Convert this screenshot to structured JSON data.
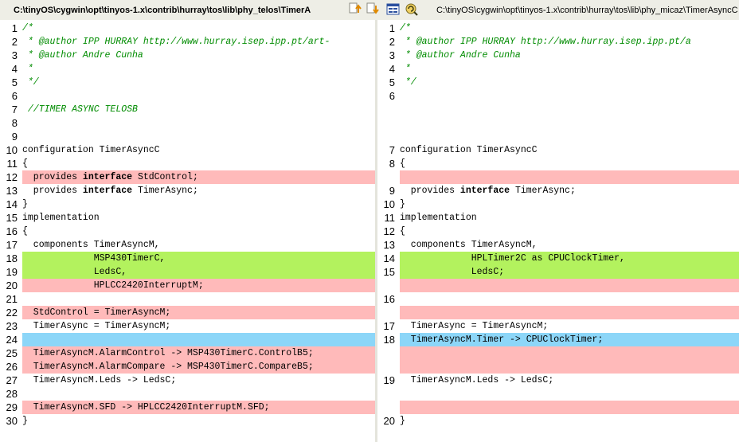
{
  "header": {
    "left_path": "C:\\tinyOS\\cygwin\\opt\\tinyos-1.x\\contrib\\hurray\\tos\\lib\\phy_telos\\TimerA",
    "right_path": "C:\\tinyOS\\cygwin\\opt\\tinyos-1.x\\contrib\\hurray\\tos\\lib\\phy_micaz\\TimerAsyncC",
    "buttons": [
      "up-arrow-icon",
      "down-arrow-icon",
      "layout-icon",
      "refresh-icon"
    ]
  },
  "left_lines": [
    {
      "n": "1",
      "t": "/*",
      "k": "cmt",
      "bg": ""
    },
    {
      "n": "2",
      "t": " * @author IPP HURRAY http://www.hurray.isep.ipp.pt/art-",
      "k": "cmt",
      "bg": ""
    },
    {
      "n": "3",
      "t": " * @author Andre Cunha",
      "k": "cmt",
      "bg": ""
    },
    {
      "n": "4",
      "t": " *",
      "k": "cmt",
      "bg": ""
    },
    {
      "n": "5",
      "t": " */",
      "k": "cmt",
      "bg": ""
    },
    {
      "n": "6",
      "t": "",
      "k": "",
      "bg": ""
    },
    {
      "n": "7",
      "t": " //TIMER ASYNC TELOSB",
      "k": "cmt",
      "bg": ""
    },
    {
      "n": "8",
      "t": "",
      "k": "",
      "bg": ""
    },
    {
      "n": "9",
      "t": "",
      "k": "",
      "bg": ""
    },
    {
      "n": "10",
      "t": "configuration TimerAsyncC",
      "k": "",
      "bg": ""
    },
    {
      "n": "11",
      "t": "{",
      "k": "",
      "bg": ""
    },
    {
      "n": "12",
      "t": "  provides |interface| StdControl;",
      "k": "",
      "bg": "d"
    },
    {
      "n": "13",
      "t": "  provides |interface| TimerAsync;",
      "k": "",
      "bg": ""
    },
    {
      "n": "14",
      "t": "}",
      "k": "",
      "bg": ""
    },
    {
      "n": "15",
      "t": "implementation",
      "k": "",
      "bg": ""
    },
    {
      "n": "16",
      "t": "{",
      "k": "",
      "bg": ""
    },
    {
      "n": "17",
      "t": "  components TimerAsyncM,",
      "k": "",
      "bg": ""
    },
    {
      "n": "18",
      "t": "             MSP430TimerC,",
      "k": "",
      "bg": "c"
    },
    {
      "n": "19",
      "t": "             LedsC,",
      "k": "",
      "bg": "c"
    },
    {
      "n": "20",
      "t": "             HPLCC2420InterruptM;",
      "k": "",
      "bg": "d"
    },
    {
      "n": "21",
      "t": "",
      "k": "",
      "bg": ""
    },
    {
      "n": "22",
      "t": "  StdControl = TimerAsyncM;",
      "k": "",
      "bg": "d"
    },
    {
      "n": "23",
      "t": "  TimerAsync = TimerAsyncM;",
      "k": "",
      "bg": ""
    },
    {
      "n": "24",
      "t": "",
      "k": "",
      "bg": "m"
    },
    {
      "n": "25",
      "t": "  TimerAsyncM.AlarmControl -> MSP430TimerC.ControlB5;",
      "k": "",
      "bg": "d"
    },
    {
      "n": "26",
      "t": "  TimerAsyncM.AlarmCompare -> MSP430TimerC.CompareB5;",
      "k": "",
      "bg": "d"
    },
    {
      "n": "27",
      "t": "  TimerAsyncM.Leds -> LedsC;",
      "k": "",
      "bg": ""
    },
    {
      "n": "28",
      "t": "",
      "k": "",
      "bg": ""
    },
    {
      "n": "29",
      "t": "  TimerAsyncM.SFD -> HPLCC2420InterruptM.SFD;",
      "k": "",
      "bg": "d"
    },
    {
      "n": "30",
      "t": "}",
      "k": "",
      "bg": ""
    }
  ],
  "right_lines": [
    {
      "n": "1",
      "t": "/*",
      "k": "cmt",
      "bg": ""
    },
    {
      "n": "2",
      "t": " * @author IPP HURRAY http://www.hurray.isep.ipp.pt/a",
      "k": "cmt",
      "bg": ""
    },
    {
      "n": "3",
      "t": " * @author Andre Cunha",
      "k": "cmt",
      "bg": ""
    },
    {
      "n": "4",
      "t": " *",
      "k": "cmt",
      "bg": ""
    },
    {
      "n": "5",
      "t": " */",
      "k": "cmt",
      "bg": ""
    },
    {
      "n": "6",
      "t": "",
      "k": "",
      "bg": ""
    },
    {
      "n": "",
      "t": "",
      "k": "",
      "bg": ""
    },
    {
      "n": "",
      "t": "",
      "k": "",
      "bg": ""
    },
    {
      "n": "",
      "t": "",
      "k": "",
      "bg": ""
    },
    {
      "n": "7",
      "t": "configuration TimerAsyncC",
      "k": "",
      "bg": ""
    },
    {
      "n": "8",
      "t": "{",
      "k": "",
      "bg": ""
    },
    {
      "n": "",
      "t": "",
      "k": "",
      "bg": "d"
    },
    {
      "n": "9",
      "t": "  provides |interface| TimerAsync;",
      "k": "",
      "bg": ""
    },
    {
      "n": "10",
      "t": "}",
      "k": "",
      "bg": ""
    },
    {
      "n": "11",
      "t": "implementation",
      "k": "",
      "bg": ""
    },
    {
      "n": "12",
      "t": "{",
      "k": "",
      "bg": ""
    },
    {
      "n": "13",
      "t": "  components TimerAsyncM,",
      "k": "",
      "bg": ""
    },
    {
      "n": "14",
      "t": "             HPLTimer2C as CPUClockTimer,",
      "k": "",
      "bg": "c"
    },
    {
      "n": "15",
      "t": "             LedsC;",
      "k": "",
      "bg": "c"
    },
    {
      "n": "",
      "t": "",
      "k": "",
      "bg": "d"
    },
    {
      "n": "16",
      "t": "",
      "k": "",
      "bg": ""
    },
    {
      "n": "",
      "t": "",
      "k": "",
      "bg": "d"
    },
    {
      "n": "17",
      "t": "  TimerAsync = TimerAsyncM;",
      "k": "",
      "bg": ""
    },
    {
      "n": "18",
      "t": "  TimerAsyncM.Timer -> CPUClockTimer;",
      "k": "",
      "bg": "m"
    },
    {
      "n": "",
      "t": "",
      "k": "",
      "bg": "d"
    },
    {
      "n": "",
      "t": "",
      "k": "",
      "bg": "d"
    },
    {
      "n": "19",
      "t": "  TimerAsyncM.Leds -> LedsC;",
      "k": "",
      "bg": ""
    },
    {
      "n": "",
      "t": "",
      "k": "",
      "bg": ""
    },
    {
      "n": "",
      "t": "",
      "k": "",
      "bg": "d"
    },
    {
      "n": "20",
      "t": "}",
      "k": "",
      "bg": ""
    }
  ]
}
